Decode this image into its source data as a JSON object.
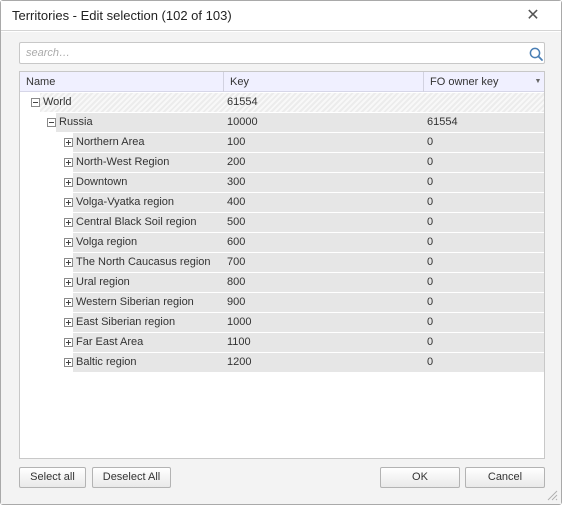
{
  "dialog": {
    "title": "Territories - Edit selection (102 of 103)",
    "close_icon": "close-icon"
  },
  "search": {
    "placeholder": "search…",
    "value": "",
    "icon": "search-icon"
  },
  "grid": {
    "columns": [
      {
        "label": "Name"
      },
      {
        "label": "Key"
      },
      {
        "label": "FO owner key"
      }
    ],
    "rows": [
      {
        "name": "World",
        "key": "61554",
        "owner": "",
        "level": 0,
        "expanded": true
      },
      {
        "name": "Russia",
        "key": "10000",
        "owner": "61554",
        "level": 1,
        "expanded": true
      },
      {
        "name": "Northern Area",
        "key": "100",
        "owner": "0",
        "level": 2,
        "expanded": false
      },
      {
        "name": "North-West Region",
        "key": "200",
        "owner": "0",
        "level": 2,
        "expanded": false
      },
      {
        "name": "Downtown",
        "key": "300",
        "owner": "0",
        "level": 2,
        "expanded": false
      },
      {
        "name": "Volga-Vyatka region",
        "key": "400",
        "owner": "0",
        "level": 2,
        "expanded": false
      },
      {
        "name": "Central Black Soil region",
        "key": "500",
        "owner": "0",
        "level": 2,
        "expanded": false
      },
      {
        "name": "Volga region",
        "key": "600",
        "owner": "0",
        "level": 2,
        "expanded": false
      },
      {
        "name": "The North Caucasus region",
        "key": "700",
        "owner": "0",
        "level": 2,
        "expanded": false
      },
      {
        "name": "Ural region",
        "key": "800",
        "owner": "0",
        "level": 2,
        "expanded": false
      },
      {
        "name": "Western Siberian region",
        "key": "900",
        "owner": "0",
        "level": 2,
        "expanded": false
      },
      {
        "name": "East Siberian region",
        "key": "1000",
        "owner": "0",
        "level": 2,
        "expanded": false
      },
      {
        "name": "Far East Area",
        "key": "1100",
        "owner": "0",
        "level": 2,
        "expanded": false
      },
      {
        "name": "Baltic region",
        "key": "1200",
        "owner": "0",
        "level": 2,
        "expanded": false
      }
    ],
    "scrollbar_grip": "|||"
  },
  "buttons": {
    "select_all": "Select all",
    "deselect_all": "Deselect All",
    "ok": "OK",
    "cancel": "Cancel"
  },
  "colors": {
    "selected_row_bg": "#e6e6e6",
    "header_bg": "#f0f0ff",
    "dialog_bg": "#f3f3f3"
  }
}
